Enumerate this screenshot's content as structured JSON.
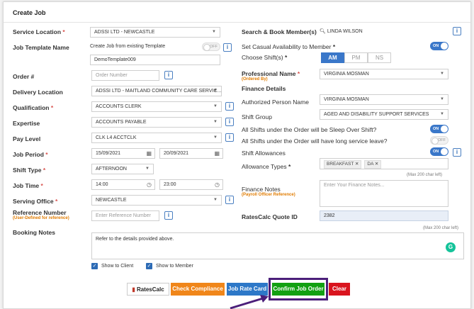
{
  "page_title": "Create Job",
  "left": {
    "service_location": {
      "label": "Service Location",
      "value": "ADSSI LTD - NEWCASTLE"
    },
    "job_template_name": {
      "label": "Job Template Name",
      "toggle_text": "Create Job from existing Template",
      "toggle_state": "OFF",
      "value": "DemoTemplate009"
    },
    "order_no": {
      "label": "Order #",
      "placeholder": "Order Number"
    },
    "delivery_location": {
      "label": "Delivery Location",
      "value": "ADSSI LTD - MAITLAND COMMUNITY CARE SERVIC..."
    },
    "qualification": {
      "label": "Qualification",
      "value": "ACCOUNTS CLERK"
    },
    "expertise": {
      "label": "Expertise",
      "value": "ACCOUNTS PAYABLE"
    },
    "pay_level": {
      "label": "Pay Level",
      "value": "CLK L4 ACCTCLK"
    },
    "job_period": {
      "label": "Job Period",
      "start": "15/09/2021",
      "end": "20/09/2021"
    },
    "shift_type": {
      "label": "Shift Type",
      "value": "AFTERNOON"
    },
    "job_time": {
      "label": "Job Time",
      "start": "14:00",
      "end": "23:00"
    },
    "serving_office": {
      "label": "Serving Office",
      "value": "NEWCASTLE"
    },
    "reference_number": {
      "label": "Reference Number",
      "sub": "(User-Defined for reference)",
      "placeholder": "Enter Reference Number"
    }
  },
  "right": {
    "search_member": {
      "label": "Search & Book Member(s)",
      "value": "LINDA WILSON"
    },
    "casual_availability": {
      "label": "Set Casual Availability to Member",
      "toggle_state": "ON"
    },
    "choose_shift": {
      "label": "Choose Shift(s)",
      "options": [
        "AM",
        "PM",
        "NS"
      ],
      "selected": "AM"
    },
    "professional_name": {
      "label": "Professional Name",
      "sub": "(Ordered By)",
      "value": "VIRGINIA MOSMAN"
    },
    "finance_details": "Finance Details",
    "authorized_person": {
      "label": "Authorized Person Name",
      "value": "VIRGINIA MOSMAN"
    },
    "shift_group": {
      "label": "Shift Group",
      "value": "AGED AND DISABILITY SUPPORT SERVICES"
    },
    "sleep_over": {
      "label": "All Shifts under the Order will be Sleep Over Shift?",
      "toggle_state": "ON"
    },
    "long_service": {
      "label": "All Shifts under the Order will have long service leave?",
      "toggle_state": "OFF"
    },
    "shift_allowances": {
      "label": "Shift Allowances",
      "toggle_state": "ON"
    },
    "allowance_types": {
      "label": "Allowance Types",
      "tags": [
        "BREAKFAST",
        "DA"
      ]
    },
    "max_chars": "(Max 200 char left)",
    "finance_notes": {
      "label": "Finance Notes",
      "sub": "(Payroll Officer Reference)",
      "placeholder": "Enter Your Finance Notes..."
    },
    "ratescalc_quote": {
      "label": "RatesCalc Quote ID",
      "value": "2382"
    }
  },
  "booking_notes": {
    "label": "Booking Notes",
    "max_chars": "(Max 200 char left)",
    "value": "Refer to the details provided above."
  },
  "checkboxes": {
    "show_client": "Show to Client",
    "show_member": "Show to Member"
  },
  "buttons": {
    "ratescalc": "RatesCalc",
    "check_compliance": "Check Compliance",
    "job_rate_card": "Job Rate Card",
    "confirm": "Confirm Job Order",
    "clear": "Clear"
  },
  "colors": {
    "primary": "#3a77c9",
    "orange": "#f0861a",
    "green": "#12a012",
    "red": "#d9141e",
    "highlight": "#4b1f7a"
  }
}
